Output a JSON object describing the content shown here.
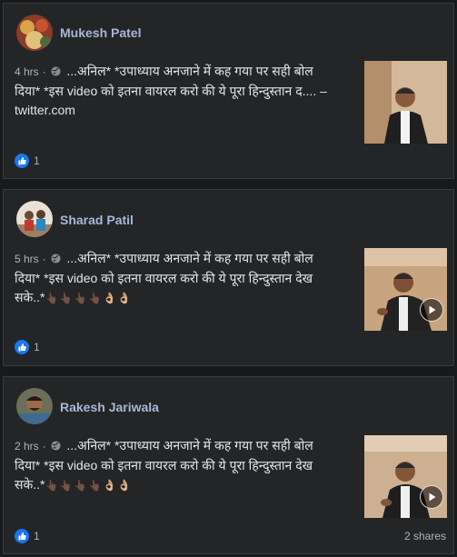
{
  "posts": [
    {
      "author": "Mukesh Patel",
      "time": "4 hrs",
      "separator": "·",
      "text_lines": [
        "...अनिल* *उपाध्याय अनजाने में कह गया पर सही बोल",
        "दिया* *इस video को इतना वायरल करो की ये पूरा हिन्दुस्तान द.... –",
        "twitter.com"
      ],
      "emoji": "",
      "likes": "1",
      "shares": "",
      "video": false
    },
    {
      "author": "Sharad Patil",
      "time": "5 hrs",
      "separator": "·",
      "text_lines": [
        "...अनिल* *उपाध्याय अनजाने में कह गया पर सही बोल",
        "दिया* *इस video को इतना वायरल करो की ये पूरा हिन्दुस्तान देख",
        "सके..*"
      ],
      "emoji": "👆🏿👆🏿👆🏿👆🏿👌🏼👌🏼",
      "likes": "1",
      "shares": "",
      "video": true
    },
    {
      "author": "Rakesh Jariwala",
      "time": "2 hrs",
      "separator": "·",
      "text_lines": [
        "...अनिल* *उपाध्याय अनजाने में कह गया पर सही बोल",
        "दिया* *इस video को इतना वायरल करो की ये पूरा हिन्दुस्तान देख",
        "सके..*"
      ],
      "emoji": "👆🏿👆🏿👆🏿👆🏿👌🏼👌🏼",
      "likes": "1",
      "shares": "2 shares",
      "video": true
    }
  ],
  "icons": {
    "privacy": "globe-icon",
    "reaction": "thumbs-up-icon",
    "video": "play-icon"
  },
  "colors": {
    "background": "#18191a",
    "card": "#242526",
    "author": "#a6b8d8",
    "like": "#1877f2"
  }
}
